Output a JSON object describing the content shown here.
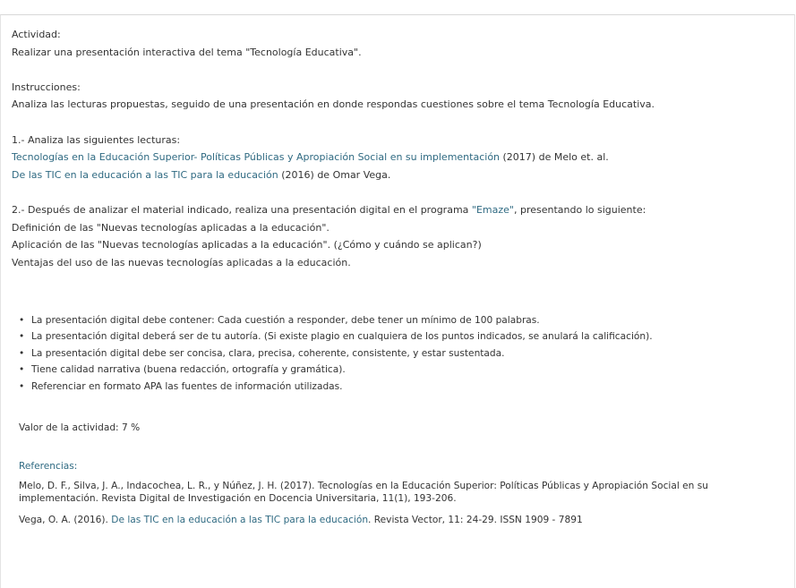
{
  "activity_label": "Actividad:",
  "activity_text": "Realizar una presentación interactiva del tema \"Tecnología Educativa\".",
  "instructions_label": "Instrucciones:",
  "instructions_text": "Analiza las lecturas propuestas, seguido de una presentación en donde respondas cuestiones sobre el tema Tecnología Educativa.",
  "step1_label": "1.- Analiza las siguientes lecturas:",
  "reading1": {
    "link_text": "Tecnologías en la Educación Superior- Políticas Públicas y Apropiación Social en su implementación",
    "suffix": " (2017) de Melo et. al."
  },
  "reading2": {
    "link_text": "De las TIC en la educación a las TIC para la educación",
    "suffix": " (2016) de Omar Vega."
  },
  "step2": {
    "prefix": "2.- Después de analizar el material indicado, realiza una presentación digital en el programa ",
    "link_text": "\"Emaze\"",
    "suffix": ", presentando lo siguiente:"
  },
  "items": [
    "Definición de las \"Nuevas tecnologías aplicadas a la educación\".",
    "Aplicación de las \"Nuevas tecnologías aplicadas a la educación\". (¿Cómo y cuándo se aplican?)",
    "Ventajas del uso de las nuevas tecnologías aplicadas a la educación."
  ],
  "criteria": [
    "La presentación digital debe contener: Cada cuestión a responder, debe tener un mínimo de 100 palabras.",
    "La presentación digital deberá ser de tu autoría. (Si existe plagio en cualquiera de los puntos indicados, se anulará la calificación).",
    "La presentación digital debe ser concisa, clara, precisa, coherente, consistente, y estar sustentada.",
    "Tiene calidad narrativa (buena redacción, ortografía y gramática).",
    "Referenciar en formato APA las fuentes de información utilizadas."
  ],
  "bullet_glyph": "•",
  "value_text": "Valor de la actividad: 7 %",
  "references_title": "Referencias:",
  "ref1_text": "Melo, D. F., Silva, J. A., Indacochea, L. R., y Núñez, J. H. (2017). Tecnologías en la Educación Superior: Políticas Públicas y Apropiación Social en su implementación. Revista Digital de Investigación en Docencia Universitaria, 11(1), 193-206.",
  "ref2": {
    "prefix": "Vega, O. A. (2016). ",
    "link_text": "De las TIC en la educación a las TIC para la educación",
    "suffix": ". Revista Vector, 11: 24-29. ISSN 1909 - 7891"
  },
  "colors": {
    "text": "#333333",
    "link": "#2f6a82",
    "border": "#d8d8d8"
  }
}
